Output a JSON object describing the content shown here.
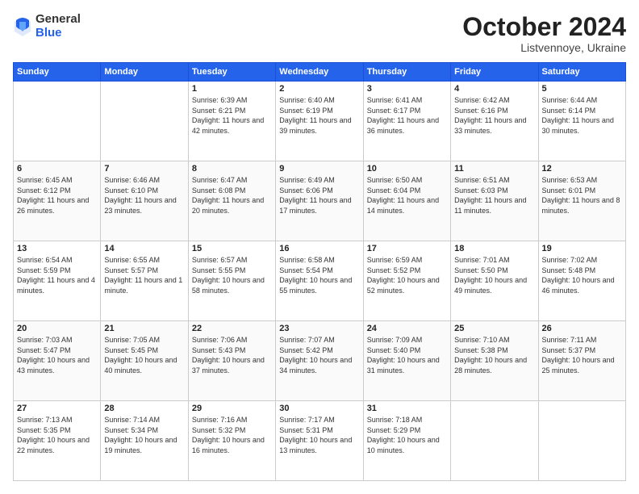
{
  "logo": {
    "general": "General",
    "blue": "Blue"
  },
  "header": {
    "month": "October 2024",
    "location": "Listvennoye, Ukraine"
  },
  "weekdays": [
    "Sunday",
    "Monday",
    "Tuesday",
    "Wednesday",
    "Thursday",
    "Friday",
    "Saturday"
  ],
  "weeks": [
    [
      {
        "day": "",
        "detail": ""
      },
      {
        "day": "",
        "detail": ""
      },
      {
        "day": "1",
        "detail": "Sunrise: 6:39 AM\nSunset: 6:21 PM\nDaylight: 11 hours and 42 minutes."
      },
      {
        "day": "2",
        "detail": "Sunrise: 6:40 AM\nSunset: 6:19 PM\nDaylight: 11 hours and 39 minutes."
      },
      {
        "day": "3",
        "detail": "Sunrise: 6:41 AM\nSunset: 6:17 PM\nDaylight: 11 hours and 36 minutes."
      },
      {
        "day": "4",
        "detail": "Sunrise: 6:42 AM\nSunset: 6:16 PM\nDaylight: 11 hours and 33 minutes."
      },
      {
        "day": "5",
        "detail": "Sunrise: 6:44 AM\nSunset: 6:14 PM\nDaylight: 11 hours and 30 minutes."
      }
    ],
    [
      {
        "day": "6",
        "detail": "Sunrise: 6:45 AM\nSunset: 6:12 PM\nDaylight: 11 hours and 26 minutes."
      },
      {
        "day": "7",
        "detail": "Sunrise: 6:46 AM\nSunset: 6:10 PM\nDaylight: 11 hours and 23 minutes."
      },
      {
        "day": "8",
        "detail": "Sunrise: 6:47 AM\nSunset: 6:08 PM\nDaylight: 11 hours and 20 minutes."
      },
      {
        "day": "9",
        "detail": "Sunrise: 6:49 AM\nSunset: 6:06 PM\nDaylight: 11 hours and 17 minutes."
      },
      {
        "day": "10",
        "detail": "Sunrise: 6:50 AM\nSunset: 6:04 PM\nDaylight: 11 hours and 14 minutes."
      },
      {
        "day": "11",
        "detail": "Sunrise: 6:51 AM\nSunset: 6:03 PM\nDaylight: 11 hours and 11 minutes."
      },
      {
        "day": "12",
        "detail": "Sunrise: 6:53 AM\nSunset: 6:01 PM\nDaylight: 11 hours and 8 minutes."
      }
    ],
    [
      {
        "day": "13",
        "detail": "Sunrise: 6:54 AM\nSunset: 5:59 PM\nDaylight: 11 hours and 4 minutes."
      },
      {
        "day": "14",
        "detail": "Sunrise: 6:55 AM\nSunset: 5:57 PM\nDaylight: 11 hours and 1 minute."
      },
      {
        "day": "15",
        "detail": "Sunrise: 6:57 AM\nSunset: 5:55 PM\nDaylight: 10 hours and 58 minutes."
      },
      {
        "day": "16",
        "detail": "Sunrise: 6:58 AM\nSunset: 5:54 PM\nDaylight: 10 hours and 55 minutes."
      },
      {
        "day": "17",
        "detail": "Sunrise: 6:59 AM\nSunset: 5:52 PM\nDaylight: 10 hours and 52 minutes."
      },
      {
        "day": "18",
        "detail": "Sunrise: 7:01 AM\nSunset: 5:50 PM\nDaylight: 10 hours and 49 minutes."
      },
      {
        "day": "19",
        "detail": "Sunrise: 7:02 AM\nSunset: 5:48 PM\nDaylight: 10 hours and 46 minutes."
      }
    ],
    [
      {
        "day": "20",
        "detail": "Sunrise: 7:03 AM\nSunset: 5:47 PM\nDaylight: 10 hours and 43 minutes."
      },
      {
        "day": "21",
        "detail": "Sunrise: 7:05 AM\nSunset: 5:45 PM\nDaylight: 10 hours and 40 minutes."
      },
      {
        "day": "22",
        "detail": "Sunrise: 7:06 AM\nSunset: 5:43 PM\nDaylight: 10 hours and 37 minutes."
      },
      {
        "day": "23",
        "detail": "Sunrise: 7:07 AM\nSunset: 5:42 PM\nDaylight: 10 hours and 34 minutes."
      },
      {
        "day": "24",
        "detail": "Sunrise: 7:09 AM\nSunset: 5:40 PM\nDaylight: 10 hours and 31 minutes."
      },
      {
        "day": "25",
        "detail": "Sunrise: 7:10 AM\nSunset: 5:38 PM\nDaylight: 10 hours and 28 minutes."
      },
      {
        "day": "26",
        "detail": "Sunrise: 7:11 AM\nSunset: 5:37 PM\nDaylight: 10 hours and 25 minutes."
      }
    ],
    [
      {
        "day": "27",
        "detail": "Sunrise: 7:13 AM\nSunset: 5:35 PM\nDaylight: 10 hours and 22 minutes."
      },
      {
        "day": "28",
        "detail": "Sunrise: 7:14 AM\nSunset: 5:34 PM\nDaylight: 10 hours and 19 minutes."
      },
      {
        "day": "29",
        "detail": "Sunrise: 7:16 AM\nSunset: 5:32 PM\nDaylight: 10 hours and 16 minutes."
      },
      {
        "day": "30",
        "detail": "Sunrise: 7:17 AM\nSunset: 5:31 PM\nDaylight: 10 hours and 13 minutes."
      },
      {
        "day": "31",
        "detail": "Sunrise: 7:18 AM\nSunset: 5:29 PM\nDaylight: 10 hours and 10 minutes."
      },
      {
        "day": "",
        "detail": ""
      },
      {
        "day": "",
        "detail": ""
      }
    ]
  ]
}
